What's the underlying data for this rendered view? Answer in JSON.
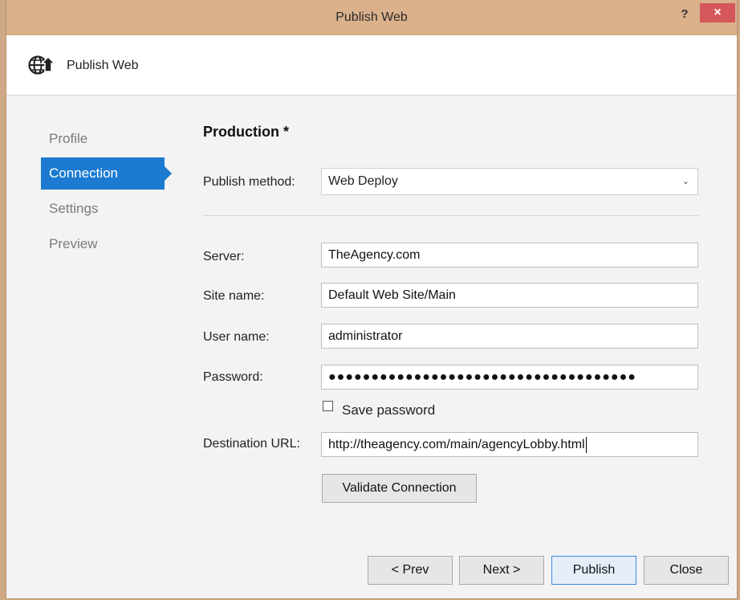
{
  "window": {
    "title": "Publish Web",
    "help_glyph": "?",
    "close_glyph": "×"
  },
  "header": {
    "icon": "globe-publish-icon",
    "title": "Publish Web"
  },
  "nav": {
    "items": [
      {
        "label": "Profile",
        "active": false
      },
      {
        "label": "Connection",
        "active": true
      },
      {
        "label": "Settings",
        "active": false
      },
      {
        "label": "Preview",
        "active": false
      }
    ]
  },
  "connection": {
    "profile_title": "Production *",
    "publish_method_label": "Publish method:",
    "publish_method_value": "Web Deploy",
    "server_label": "Server:",
    "server_value": "TheAgency.com",
    "site_name_label": "Site name:",
    "site_name_value": "Default Web Site/Main",
    "user_name_label": "User name:",
    "user_name_value": "administrator",
    "password_label": "Password:",
    "password_value": "●●●●●●●●●●●●●●●●●●●●●●●●●●●●●●●●●●●●",
    "save_password_label": "Save password",
    "save_password_checked": false,
    "destination_url_label": "Destination URL:",
    "destination_url_value": "http://theagency.com/main/agencyLobby.html",
    "validate_button_label": "Validate Connection"
  },
  "footer": {
    "prev_label": "< Prev",
    "next_label": "Next >",
    "publish_label": "Publish",
    "close_label": "Close"
  },
  "colors": {
    "titlebar": "#dbb18b",
    "accent": "#1c7bd1",
    "close_button": "#d4575c"
  }
}
